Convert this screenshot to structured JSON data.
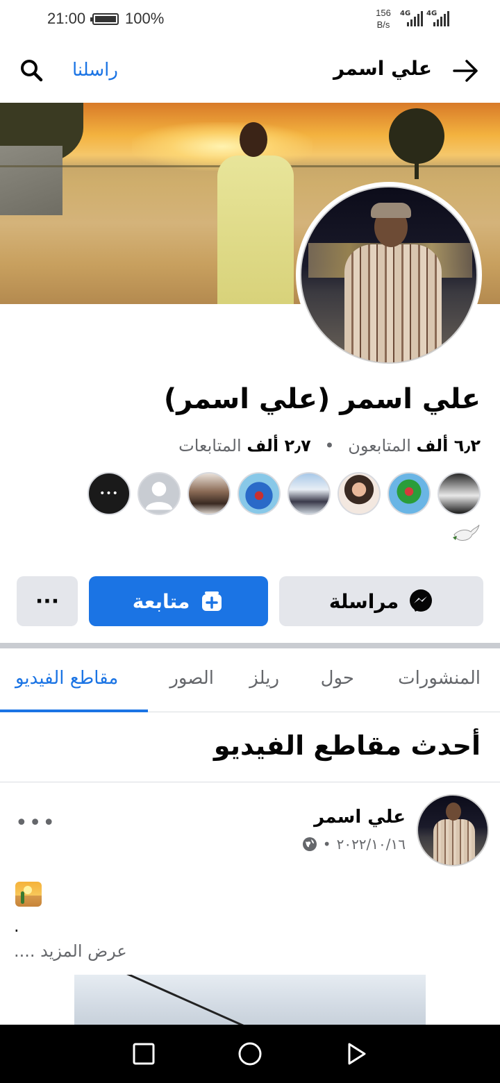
{
  "status_bar": {
    "time": "21:00",
    "battery": "100%",
    "net_speed_value": "156",
    "net_speed_unit": "B/s",
    "signal_1": "4G",
    "signal_2": "4G"
  },
  "topbar": {
    "title": "علي اسمر",
    "contact_link": "راسلنا"
  },
  "profile": {
    "name": "علي اسمر (علي اسمر)",
    "followers_count": "٦٫٢ ألف",
    "followers_label": "المتابعون",
    "separator": "•",
    "following_count": "٢٫٧ ألف",
    "following_label": "المتابعات"
  },
  "friends": {
    "more_label": "•••"
  },
  "actions": {
    "message_label": "مراسلة",
    "follow_label": "متابعة",
    "more_label": "···"
  },
  "tabs": [
    {
      "label": "المنشورات",
      "active": false
    },
    {
      "label": "حول",
      "active": false
    },
    {
      "label": "ريلز",
      "active": false
    },
    {
      "label": "الصور",
      "active": false
    },
    {
      "label": "مقاطع الفيديو",
      "active": true
    }
  ],
  "section": {
    "title": "أحدث مقاطع الفيديو"
  },
  "post": {
    "author": "علي اسمر",
    "date": "٢٠٢٢/١٠/١٦",
    "meta_sep": "•",
    "more": "•••",
    "body_dot": ".",
    "see_more": "عرض المزيد ...."
  },
  "colors": {
    "accent": "#1b74e4",
    "button_gray": "#e4e6eb",
    "muted_text": "#65676b"
  },
  "icons": {
    "back": "arrow-right-icon",
    "search": "search-icon",
    "messenger": "messenger-icon",
    "follow": "follow-add-icon",
    "globe": "globe-icon",
    "dove": "dove-icon"
  }
}
